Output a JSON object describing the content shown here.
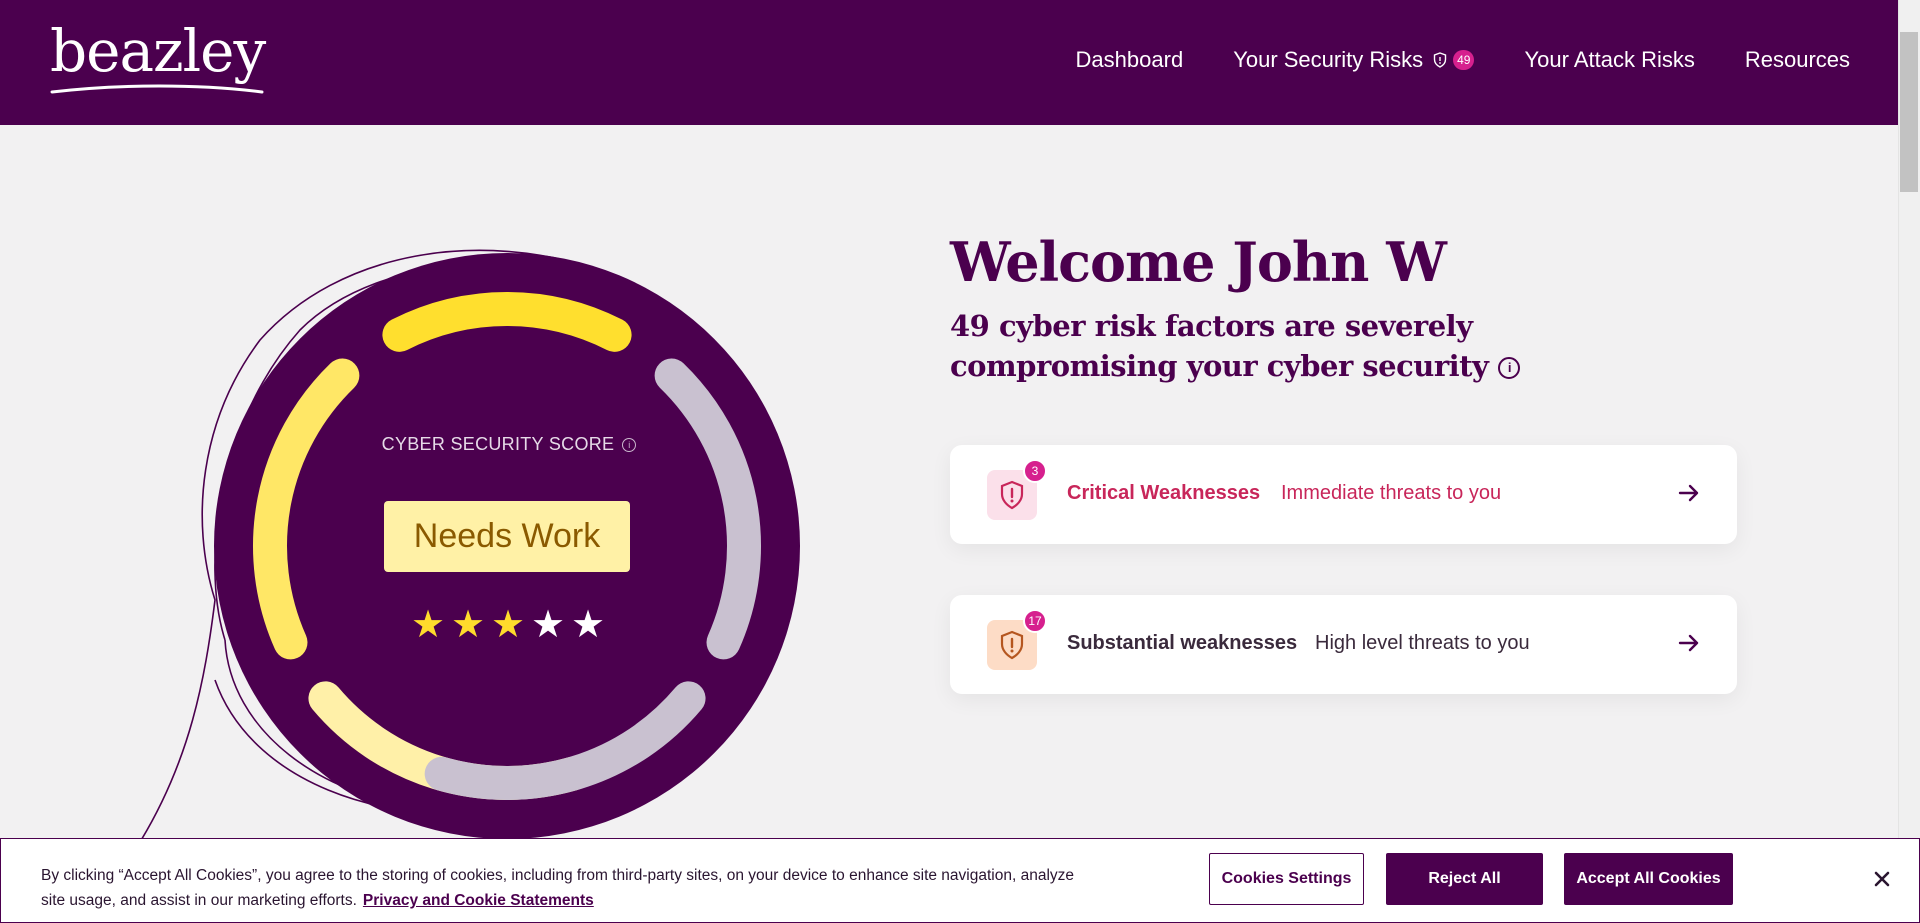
{
  "header": {
    "logo_text": "beazley",
    "nav": {
      "dashboard": "Dashboard",
      "security_risks": "Your Security Risks",
      "security_risks_count": "49",
      "attack_risks": "Your Attack Risks",
      "resources": "Resources"
    }
  },
  "score": {
    "label": "CYBER SECURITY SCORE",
    "info_glyph": "i",
    "rating": "Needs Work",
    "stars_total": 5,
    "stars_filled": 3,
    "star_glyph": "★",
    "segments_filled": 3,
    "segments_total": 6
  },
  "welcome": {
    "title": "Welcome John W",
    "subtitle": "49 cyber risk factors are severely compromising your cyber security",
    "info_glyph": "i"
  },
  "cards": [
    {
      "count": "3",
      "title": "Critical Weaknesses",
      "description": "Immediate threats to you",
      "color": "#c8265a"
    },
    {
      "count": "17",
      "title": "Substantial weaknesses",
      "description": "High level threats to you",
      "color": "#b5561f"
    }
  ],
  "cookie": {
    "text": "By clicking “Accept All Cookies”, you agree to the storing of cookies, including from third-party sites, on your device to enhance site navigation, analyze site usage, and assist in our marketing efforts.",
    "link": "Privacy and Cookie Statements",
    "settings": "Cookies Settings",
    "reject": "Reject All",
    "accept": "Accept All Cookies",
    "close_glyph": "×"
  },
  "colors": {
    "brand": "#4b004e",
    "accent": "#d6208e",
    "segment_bright": "#ffdf2e",
    "segment_mid": "#ffe766",
    "segment_light": "#fff0a8",
    "segment_empty": "#c9c1d0",
    "star_filled": "#ffdb2c",
    "star_empty": "#ffffff"
  }
}
